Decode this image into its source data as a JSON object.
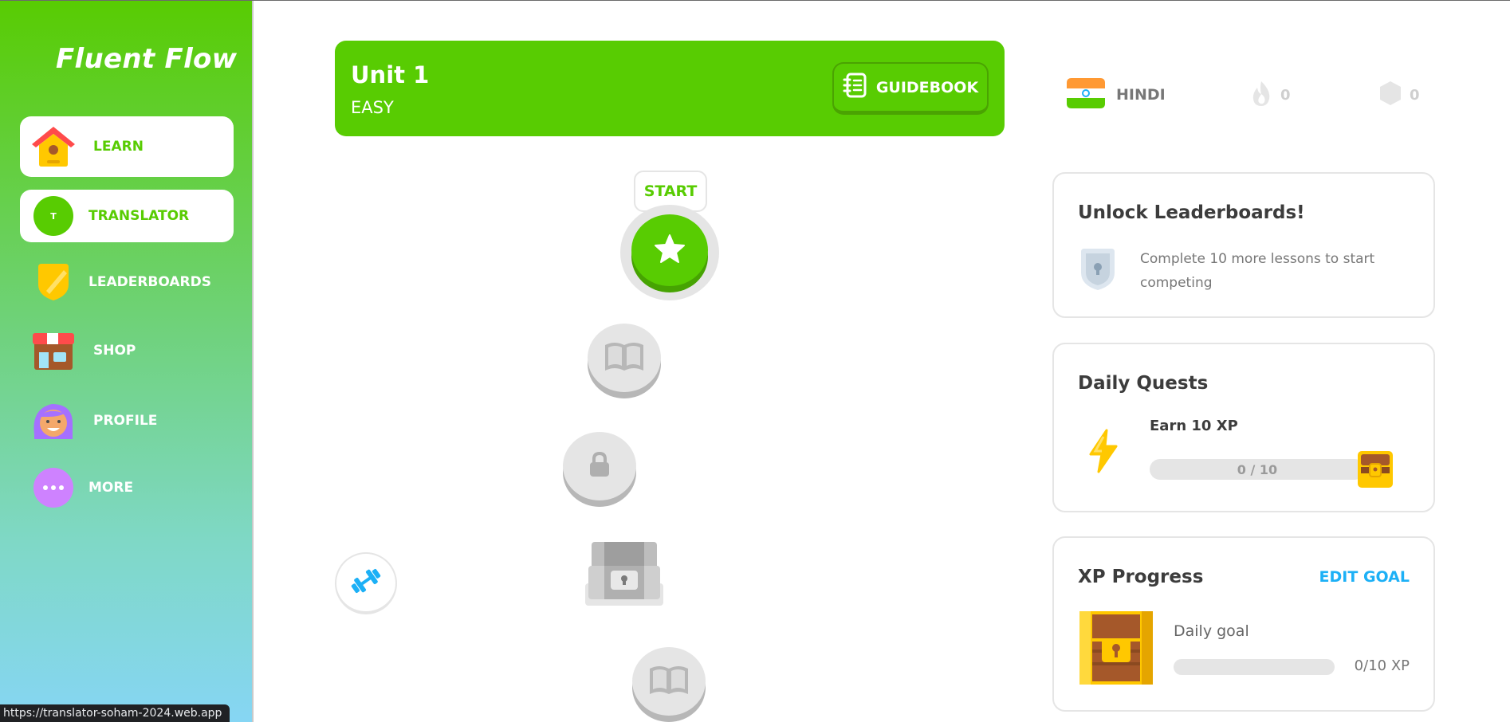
{
  "sidebar": {
    "brand": "Fluent Flow",
    "items": [
      {
        "label": "LEARN",
        "icon": "house-icon"
      },
      {
        "label": "TRANSLATOR",
        "icon": "translator-icon",
        "badge": "T"
      },
      {
        "label": "LEADERBOARDS",
        "icon": "shield-icon"
      },
      {
        "label": "SHOP",
        "icon": "shop-icon"
      },
      {
        "label": "PROFILE",
        "icon": "avatar-icon"
      },
      {
        "label": "MORE",
        "icon": "more-icon"
      }
    ]
  },
  "unit": {
    "title": "Unit 1",
    "subtitle": "EASY",
    "guidebook_label": "GUIDEBOOK"
  },
  "path": {
    "start_label": "START",
    "nodes": [
      "star-icon",
      "book-icon",
      "lock-icon",
      "chest-icon",
      "book-icon"
    ]
  },
  "stats": {
    "language": "HINDI",
    "streak": "0",
    "gems": "0"
  },
  "leaderboard_card": {
    "title": "Unlock Leaderboards!",
    "text": "Complete 10 more lessons to start competing"
  },
  "quests_card": {
    "title": "Daily Quests",
    "quest_name": "Earn 10 XP",
    "progress_text": "0 / 10",
    "progress_fraction": 0
  },
  "xp_card": {
    "title": "XP Progress",
    "edit_goal": "EDIT GOAL",
    "label": "Daily goal",
    "value": "0/10 XP",
    "progress_fraction": 0
  },
  "status_bar": {
    "url": "https://translator-soham-2024.web.app"
  },
  "colors": {
    "brand_green": "#58cc02",
    "link_blue": "#1cb0f6",
    "grey_node": "#e5e5e5"
  }
}
